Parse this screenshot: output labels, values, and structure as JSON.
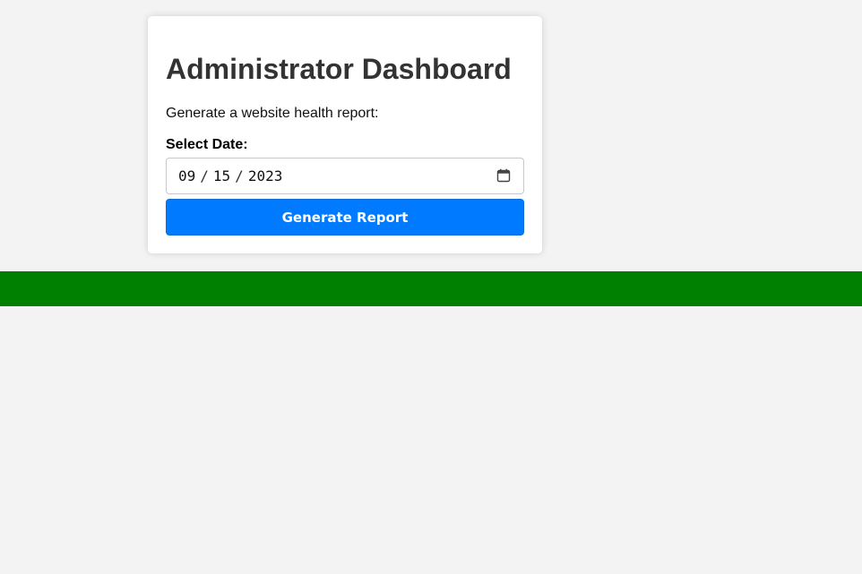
{
  "card": {
    "title": "Administrator Dashboard",
    "subtitle": "Generate a website health report:",
    "date_label": "Select Date:",
    "date": {
      "month": "09",
      "day": "15",
      "year": "2023",
      "separator": "/"
    },
    "button_label": "Generate Report"
  },
  "colors": {
    "button": "#007bff",
    "bar": "#008000",
    "background": "#f3f3f3"
  },
  "icons": {
    "date_picker": "calendar-icon"
  }
}
